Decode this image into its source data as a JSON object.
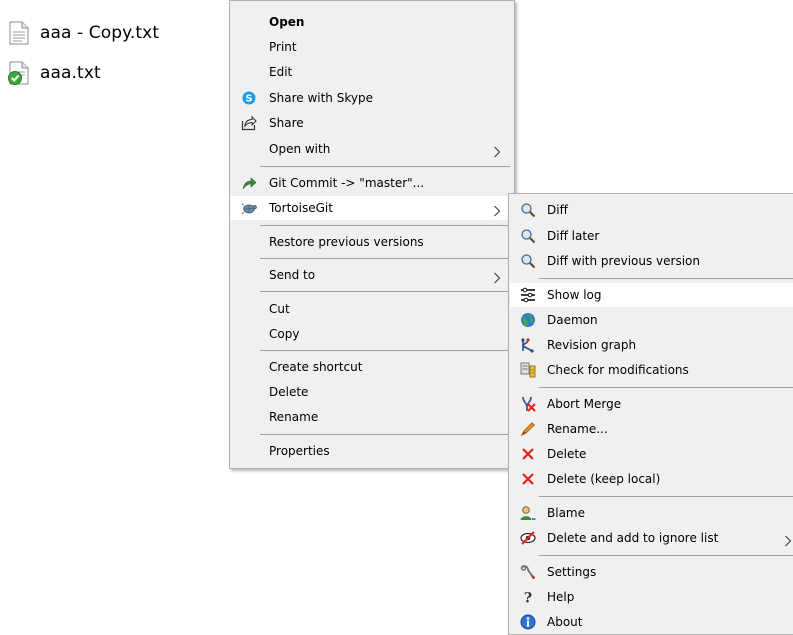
{
  "desktop": {
    "files": [
      {
        "name": "aaa - Copy.txt",
        "icon": "text-document-icon"
      },
      {
        "name": "aaa.txt",
        "icon": "git-tracked-document-icon"
      }
    ]
  },
  "context_menu": {
    "items": [
      {
        "label": "Open"
      },
      {
        "label": "Print"
      },
      {
        "label": "Edit"
      },
      {
        "label": "Share with Skype",
        "icon": "skype-icon"
      },
      {
        "label": "Share",
        "icon": "share-icon"
      },
      {
        "label": "Open with"
      },
      {
        "label": "Git Commit -> \"master\"...",
        "icon": "git-commit-icon"
      },
      {
        "label": "TortoiseGit",
        "icon": "tortoisegit-icon"
      },
      {
        "label": "Restore previous versions"
      },
      {
        "label": "Send to"
      },
      {
        "label": "Cut"
      },
      {
        "label": "Copy"
      },
      {
        "label": "Create shortcut"
      },
      {
        "label": "Delete"
      },
      {
        "label": "Rename"
      },
      {
        "label": "Properties"
      }
    ]
  },
  "tortoisegit_submenu": {
    "items": [
      {
        "label": "Diff",
        "icon": "magnifier-icon"
      },
      {
        "label": "Diff later",
        "icon": "magnifier-icon"
      },
      {
        "label": "Diff with previous version",
        "icon": "magnifier-icon"
      },
      {
        "label": "Show log",
        "icon": "log-icon"
      },
      {
        "label": "Daemon",
        "icon": "globe-icon"
      },
      {
        "label": "Revision graph",
        "icon": "revision-graph-icon"
      },
      {
        "label": "Check for modifications",
        "icon": "check-modifications-icon"
      },
      {
        "label": "Abort Merge",
        "icon": "abort-merge-icon"
      },
      {
        "label": "Rename...",
        "icon": "rename-pen-icon"
      },
      {
        "label": "Delete",
        "icon": "red-x-icon"
      },
      {
        "label": "Delete (keep local)",
        "icon": "red-x-icon"
      },
      {
        "label": "Blame",
        "icon": "blame-icon"
      },
      {
        "label": "Delete and add to ignore list",
        "icon": "ignore-icon"
      },
      {
        "label": "Settings",
        "icon": "settings-icon"
      },
      {
        "label": "Help",
        "icon": "help-icon"
      },
      {
        "label": "About",
        "icon": "info-icon"
      }
    ]
  },
  "colors": {
    "menu_background": "#f0f0f0",
    "highlight": "#ffffff",
    "separator": "#a0a0a0",
    "delete_red": "#e0241b",
    "skype_blue": "#1e9be6"
  }
}
